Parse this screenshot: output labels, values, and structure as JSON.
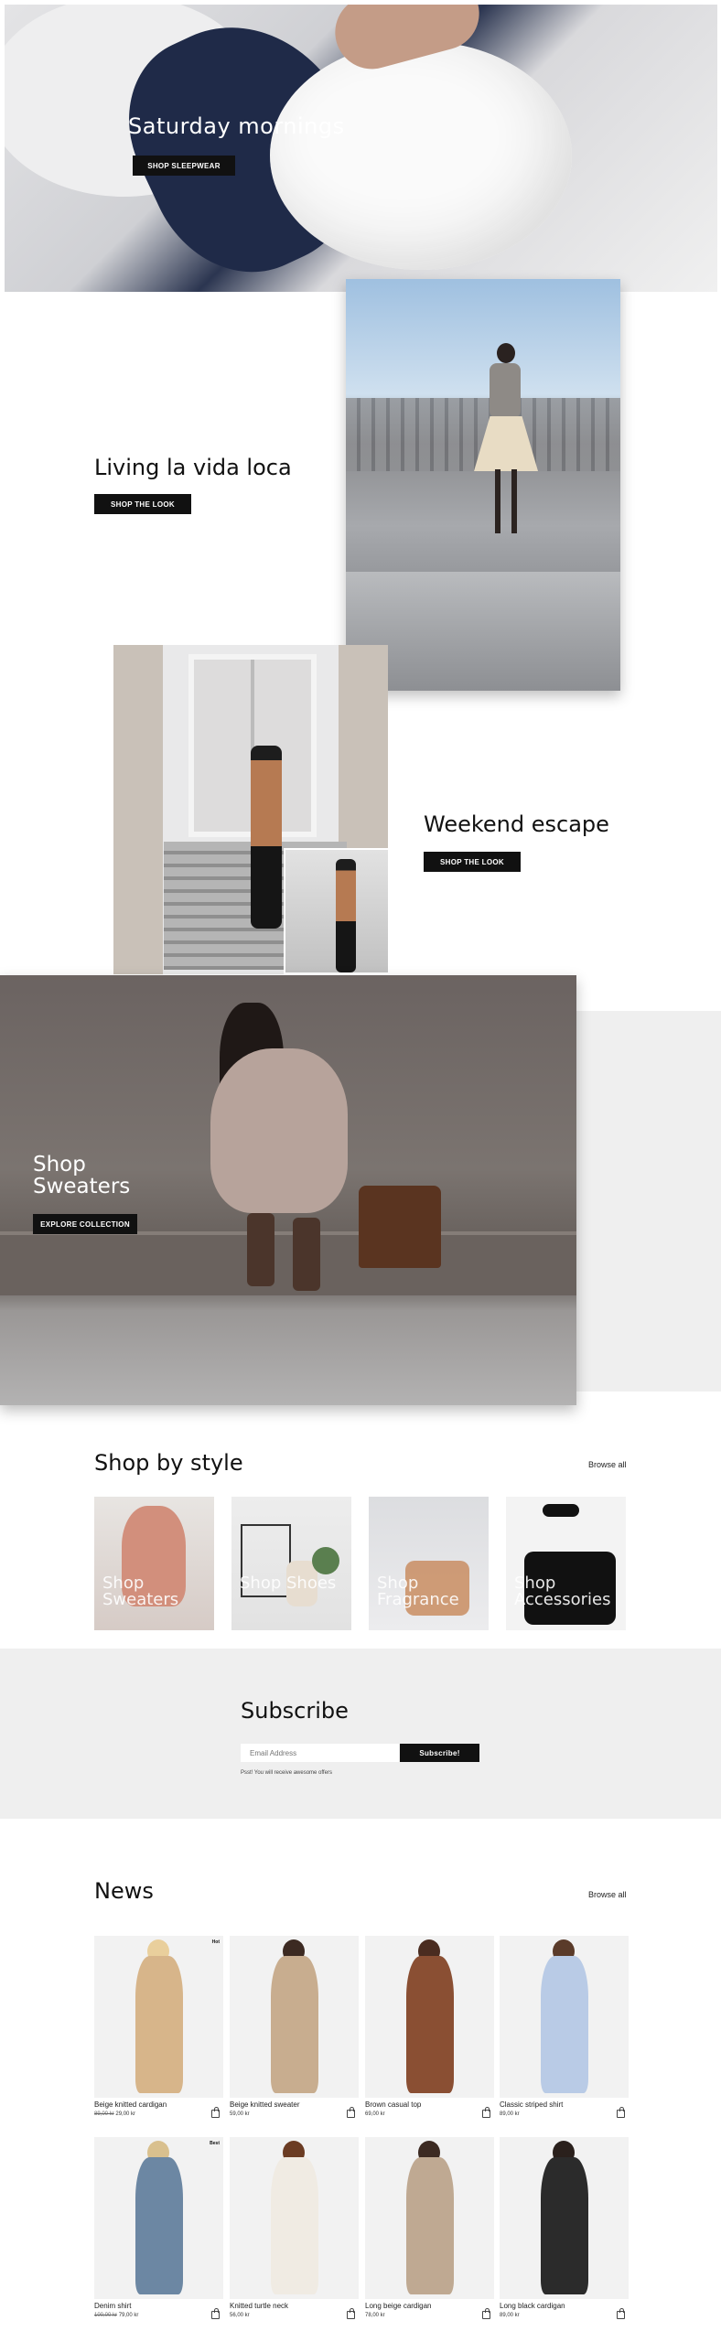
{
  "hero": {
    "title": "Saturday mornings",
    "button": "SHOP SLEEPWEAR"
  },
  "features": [
    {
      "title": "Living la vida loca",
      "button": "SHOP THE LOOK"
    },
    {
      "title": "Weekend escape",
      "button": "SHOP THE LOOK"
    },
    {
      "title": "Shop Sweaters",
      "button": "EXPLORE COLLECTION"
    }
  ],
  "shop_by_style": {
    "title": "Shop by style",
    "browse": "Browse all",
    "cards": [
      {
        "label": "Shop Sweaters"
      },
      {
        "label": "Shop Shoes"
      },
      {
        "label": "Shop Fragrance"
      },
      {
        "label": "Shop Accessories"
      }
    ]
  },
  "subscribe": {
    "title": "Subscribe",
    "placeholder": "Email Address",
    "button": "Subscribe!",
    "note": "Psst! You will receive awesome offers"
  },
  "news": {
    "title": "News",
    "browse": "Browse all",
    "products": [
      {
        "name": "Beige knitted cardigan",
        "old_price": "89,00 kr",
        "price": "29,00 kr",
        "badge": "Hot",
        "body_color": "#d7b58a",
        "head_color": "#e9cf9c"
      },
      {
        "name": "Beige knitted sweater",
        "old_price": "",
        "price": "59,00 kr",
        "badge": "",
        "body_color": "#c8ad8f",
        "head_color": "#3c2a22"
      },
      {
        "name": "Brown casual top",
        "old_price": "",
        "price": "69,00 kr",
        "badge": "",
        "body_color": "#8a4f33",
        "head_color": "#4a2c20"
      },
      {
        "name": "Classic striped shirt",
        "old_price": "",
        "price": "89,00 kr",
        "badge": "",
        "body_color": "#b9cbe6",
        "head_color": "#5a3b2a"
      },
      {
        "name": "Denim shirt",
        "old_price": "100,00 kr",
        "price": "79,00 kr",
        "badge": "Best",
        "body_color": "#6c87a3",
        "head_color": "#d9c08e"
      },
      {
        "name": "Knitted turtle neck",
        "old_price": "",
        "price": "56,00 kr",
        "badge": "",
        "body_color": "#f0ebe3",
        "head_color": "#6b3c23"
      },
      {
        "name": "Long beige cardigan",
        "old_price": "",
        "price": "78,00 kr",
        "badge": "",
        "body_color": "#bfa992",
        "head_color": "#3c2a22"
      },
      {
        "name": "Long black cardigan",
        "old_price": "",
        "price": "89,00 kr",
        "badge": "",
        "body_color": "#2b2b2b",
        "head_color": "#2a201c"
      }
    ]
  }
}
